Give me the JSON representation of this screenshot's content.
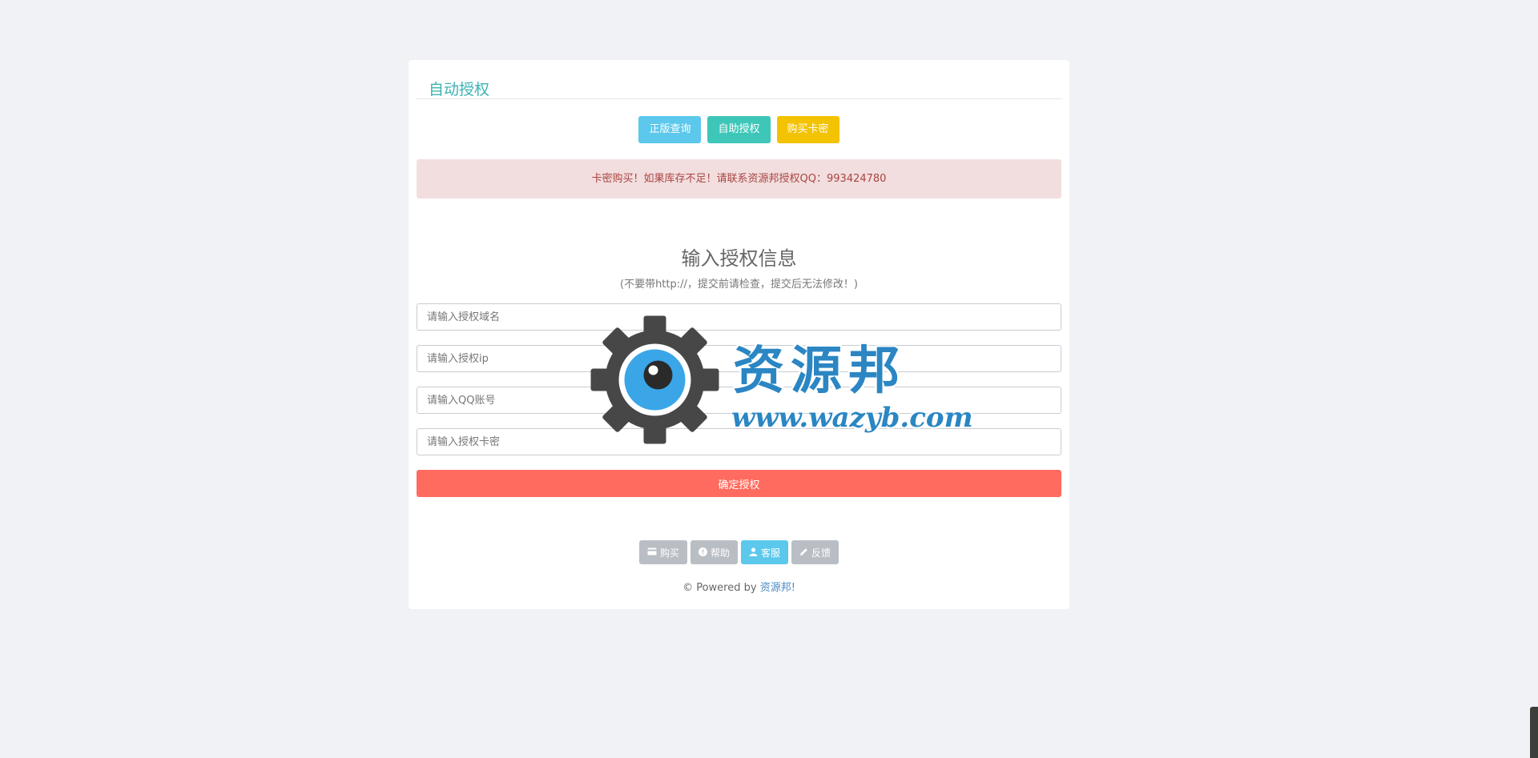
{
  "card": {
    "title": "自动授权"
  },
  "top_buttons": {
    "query": "正版查询",
    "self_auth": "自助授权",
    "buy_card": "购买卡密"
  },
  "alert": {
    "text": "卡密购买！如果库存不足！请联系资源邦授权QQ：993424780"
  },
  "form": {
    "heading": "输入授权信息",
    "subheading": "(不要带http://，提交前请检查，提交后无法修改！)",
    "domain_placeholder": "请输入授权域名",
    "ip_placeholder": "请输入授权ip",
    "qq_placeholder": "请输入QQ账号",
    "card_placeholder": "请输入授权卡密",
    "submit_label": "确定授权"
  },
  "bottom_buttons": [
    {
      "label": "购买",
      "icon": "credit-card-icon"
    },
    {
      "label": "帮助",
      "icon": "exclamation-circle-icon"
    },
    {
      "label": "客服",
      "icon": "user-icon"
    },
    {
      "label": "反馈",
      "icon": "pencil-icon"
    }
  ],
  "footer": {
    "prefix": "© Powered by ",
    "link_text": "资源邦!"
  },
  "watermark": {
    "brand": "资源邦",
    "url": "www.wazyb.com"
  },
  "colors": {
    "title": "#3cb3b3",
    "cyan": "#5bc8ec",
    "teal": "#3ec6b8",
    "yellow": "#f3c200",
    "submit": "#ff6b5e",
    "alert_bg": "#f2dede",
    "watermark": "#2b86c3"
  }
}
